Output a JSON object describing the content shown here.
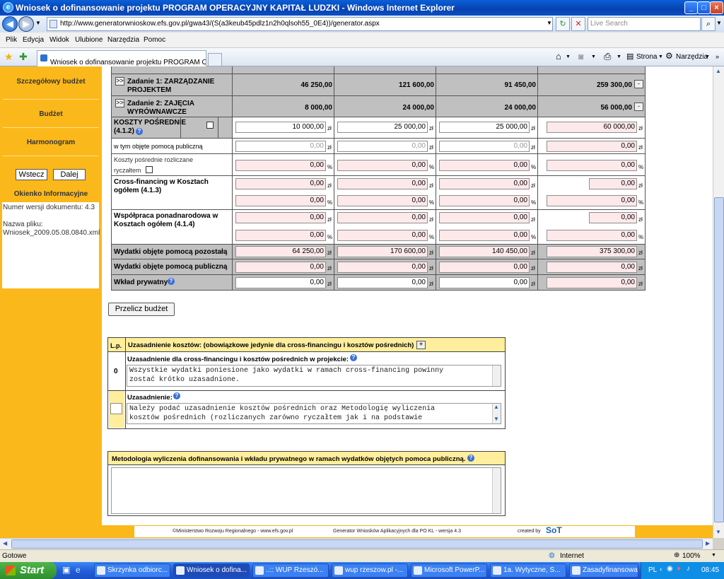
{
  "window": {
    "title": "Wniosek o dofinansowanie projektu PROGRAM OPERACYJNY KAPITAŁ LUDZKI - Windows Internet Explorer"
  },
  "addressbar": {
    "url": "http://www.generatorwnioskow.efs.gov.pl/gwa43/(S(a3keub45pdlz1n2h0qlsoh55_0E4))/generator.aspx",
    "search_placeholder": "Live Search"
  },
  "menu": [
    "Plik",
    "Edycja",
    "Widok",
    "Ulubione",
    "Narzędzia",
    "Pomoc"
  ],
  "tab": {
    "label": "Wniosek o dofinansowanie projektu PROGRAM OPER..."
  },
  "toolbar": {
    "page_label": "Strona",
    "tools_label": "Narzędzia"
  },
  "sidebar": {
    "items": [
      {
        "label": "Szczegółowy budżet"
      },
      {
        "label": "Budżet"
      },
      {
        "label": "Harmonogram"
      }
    ],
    "back_label": "Wstecz",
    "next_label": "Dalej",
    "info_title": "Okienko Informacyjne",
    "info_version": "Numer wersji dokumentu: 4.3",
    "info_filename_label": "Nazwa pliku:",
    "info_filename": "Wniosek_2009.05.08.0840.xml"
  },
  "budget": {
    "units": {
      "currency": "zł",
      "percent": "%"
    },
    "task1": {
      "label": "Zadanie 1: ZARZĄDZANIE PROJEKTEM",
      "btn": ">>",
      "values": [
        "46 250,00",
        "121 600,00",
        "91 450,00",
        "259 300,00"
      ]
    },
    "task2": {
      "label": "Zadanie 2: ZAJĘCIA WYRÓWNAWCZE",
      "btn": ">>",
      "values": [
        "8 000,00",
        "24 000,00",
        "24 000,00",
        "56 000,00"
      ]
    },
    "collapse": "-",
    "indirect": {
      "label": "KOSZTY POŚREDNIE",
      "code": "(4.1.2)",
      "values": [
        "10 000,00",
        "25 000,00",
        "25 000,00",
        "60 000,00"
      ]
    },
    "public_aid": {
      "label": "w tym objęte pomocą publiczną",
      "values": [
        "0,00",
        "0,00",
        "0,00",
        "0,00"
      ]
    },
    "flat_rate": {
      "label1": "Koszty pośrednie rozliczane",
      "label2": "ryczałtem",
      "values": [
        "0,00",
        "0,00",
        "0,00",
        "0,00"
      ]
    },
    "crossfin": {
      "label": "Cross-financing w Kosztach ogółem (4.1.3)",
      "values": [
        "0,00",
        "0,00",
        "0,00",
        "0,00"
      ],
      "pct": [
        "0,00",
        "0,00",
        "0,00",
        "0,00"
      ]
    },
    "transnational": {
      "label": "Współpraca ponadnarodowa w Kosztach ogółem (4.1.4)",
      "values": [
        "0,00",
        "0,00",
        "0,00",
        "0,00"
      ],
      "pct": [
        "0,00",
        "0,00",
        "0,00",
        "0,00"
      ]
    },
    "other_aid": {
      "label": "Wydatki objęte pomocą pozostałą",
      "values": [
        "64 250,00",
        "170 600,00",
        "140 450,00",
        "375 300,00"
      ]
    },
    "public_aid_total": {
      "label": "Wydatki objęte pomocą publiczną",
      "values": [
        "0,00",
        "0,00",
        "0,00",
        "0,00"
      ]
    },
    "private": {
      "label": "Wkład prywatny",
      "values": [
        "0,00",
        "0,00",
        "0,00",
        "0,00"
      ]
    },
    "recalc_label": "Przelicz budżet"
  },
  "justification": {
    "lp_header": "L.p.",
    "header": "Uzasadnienie kosztów: (obowiązkowe jedynie dla cross-financingu i kosztów pośrednich)",
    "add": "+",
    "row_no": "0",
    "cross_label": "Uzasadnienie dla cross-financingu i kosztów pośrednich w projekcie:",
    "cross_text": "Wszystkie wydatki poniesione jako wydatki w ramach cross-financing powinny\nzostać krótko uzasadnione.",
    "just_label": "Uzasadnienie:",
    "just_text": "Należy podać uzasadnienie kosztów pośrednich oraz Metodologię wyliczenia\nkosztów pośrednich (rozliczanych zarówno ryczałtem jak i na podstawie"
  },
  "methodology": {
    "header": "Metodologia wyliczenia dofinansowania i wkładu prywatnego w ramach wydatków objętych pomoca publiczną.",
    "text": ""
  },
  "footer": {
    "left": "©Ministerstwo Rozwoju Regionalnego - www.efs.gov.pl",
    "middle": "Generator Wniosków Aplikacyjnych dla PO KL - wersja 4.3",
    "created": "created by",
    "brand": "SoT"
  },
  "statusbar": {
    "status": "Gotowe",
    "zone": "Internet",
    "zoom": "100%"
  },
  "taskbar": {
    "start": "Start",
    "tasks": [
      "Skrzynka odbiorc...",
      "Wniosek o dofina...",
      "..:: WUP Rzeszó...",
      "wup rzeszow.pl -...",
      "Microsoft PowerP...",
      "1a. Wytyczne, S...",
      "Zasadyfinansowa..."
    ],
    "lang": "PL",
    "time": "08:45"
  }
}
